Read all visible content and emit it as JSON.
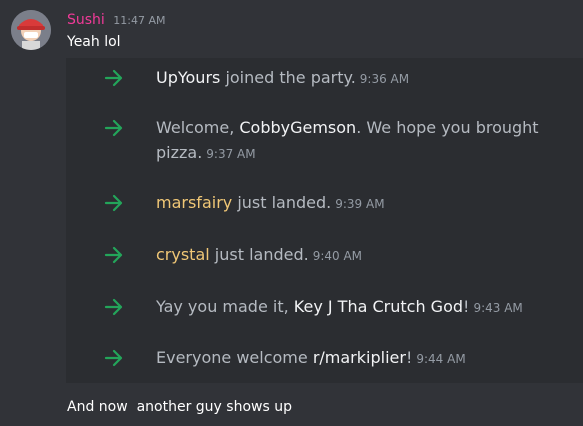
{
  "message": {
    "author": "Sushi",
    "timestamp": "11:47 AM",
    "text": "Yeah lol",
    "author_color": "#f13a98"
  },
  "joins": [
    {
      "before": "",
      "user": "UpYours",
      "after": " joined the party.",
      "time": "9:36 AM",
      "user_style": "white"
    },
    {
      "before": "Welcome, ",
      "user": "CobbyGemson",
      "after": ". We hope you brought pizza.",
      "time": "9:37 AM",
      "user_style": "white"
    },
    {
      "before": "",
      "user": "marsfairy",
      "after": " just landed.",
      "time": "9:39 AM",
      "user_style": "gold"
    },
    {
      "before": "",
      "user": "crystal",
      "after": " just landed.",
      "time": "9:40 AM",
      "user_style": "gold"
    },
    {
      "before": "Yay you made it, ",
      "user": "Key J Tha Crutch God",
      "after": "!",
      "time": "9:43 AM",
      "user_style": "white"
    },
    {
      "before": "Everyone welcome ",
      "user": "r/markiplier",
      "after": "!",
      "time": "9:44 AM",
      "user_style": "white"
    }
  ],
  "bottom_message": {
    "text": "And now  another guy shows up"
  },
  "colors": {
    "background": "#313338",
    "join_box": "#2b2d31",
    "join_arrow": "#23a55a",
    "gold_username": "#f0c776"
  },
  "icons": {
    "join_arrow": "right-arrow-icon"
  }
}
